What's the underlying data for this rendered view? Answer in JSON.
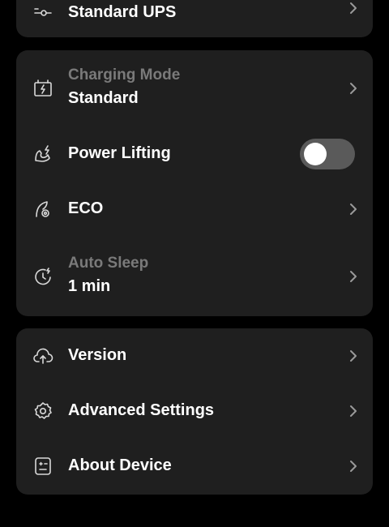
{
  "top_card": {
    "item": {
      "value": "Standard UPS",
      "icon": "ups-mode-icon"
    }
  },
  "power_card": {
    "items": [
      {
        "label": "Charging Mode",
        "value": "Standard",
        "icon": "battery-charging-icon",
        "label_muted": true
      },
      {
        "label": "Power Lifting",
        "icon": "power-lifting-icon",
        "toggle_on": false
      },
      {
        "label": "ECO",
        "icon": "eco-leaf-icon"
      },
      {
        "label": "Auto Sleep",
        "value": "1 min",
        "icon": "auto-sleep-icon",
        "label_muted": true
      }
    ]
  },
  "system_card": {
    "items": [
      {
        "label": "Version",
        "icon": "cloud-upload-icon"
      },
      {
        "label": "Advanced Settings",
        "icon": "gear-icon"
      },
      {
        "label": "About Device",
        "icon": "device-info-icon"
      }
    ]
  },
  "colors": {
    "background": "#000000",
    "card": "#1f1f1f",
    "text_primary": "#ffffff",
    "text_muted": "#7a7a7a",
    "toggle_off_track": "#5a5a5a"
  }
}
